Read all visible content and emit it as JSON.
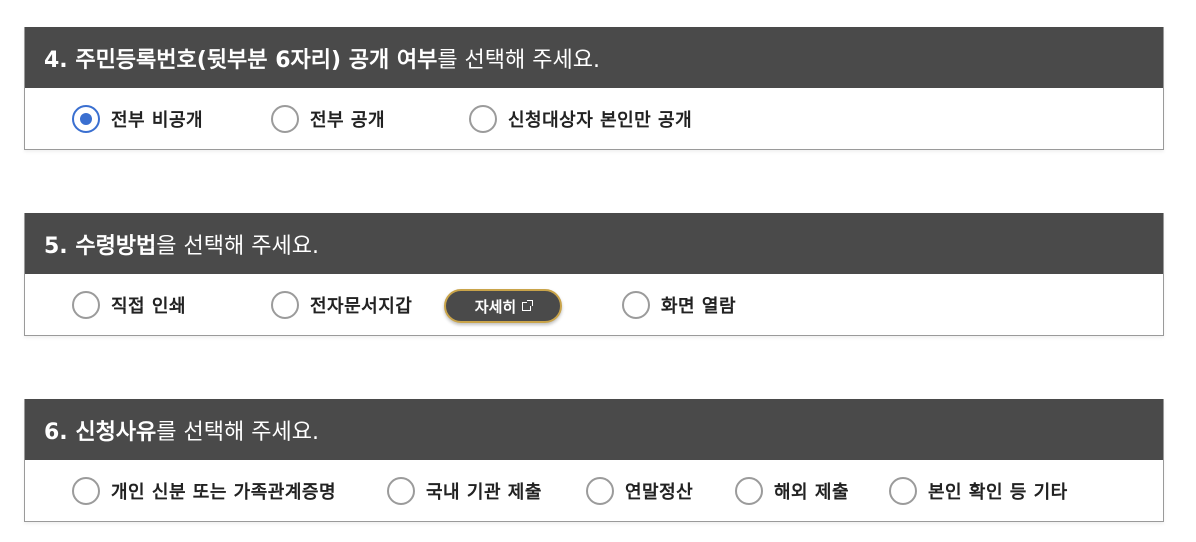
{
  "sections": [
    {
      "header_bold": "4. 주민등록번호(뒷부분 6자리) 공개 여부",
      "header_rest": "를 선택해 주세요.",
      "options": [
        {
          "label": "전부 비공개",
          "checked": true
        },
        {
          "label": "전부 공개",
          "checked": false
        },
        {
          "label": "신청대상자 본인만 공개",
          "checked": false
        }
      ]
    },
    {
      "header_bold": "5. 수령방법",
      "header_rest": "을 선택해 주세요.",
      "options": [
        {
          "label": "직접 인쇄",
          "checked": false
        },
        {
          "label": "전자문서지갑",
          "checked": false
        },
        {
          "label": "화면 열람",
          "checked": false
        }
      ],
      "detail_button": "자세히"
    },
    {
      "header_bold": "6. 신청사유",
      "header_rest": "를 선택해 주세요.",
      "options": [
        {
          "label": "개인 신분 또는 가족관계증명",
          "checked": false
        },
        {
          "label": "국내 기관 제출",
          "checked": false
        },
        {
          "label": "연말정산",
          "checked": false
        },
        {
          "label": "해외 제출",
          "checked": false
        },
        {
          "label": "본인 확인 등 기타",
          "checked": false
        }
      ]
    }
  ],
  "colors": {
    "header_bg": "#4a4a4a",
    "radio_checked": "#3a6fd0",
    "button_border": "#c9a44a"
  }
}
